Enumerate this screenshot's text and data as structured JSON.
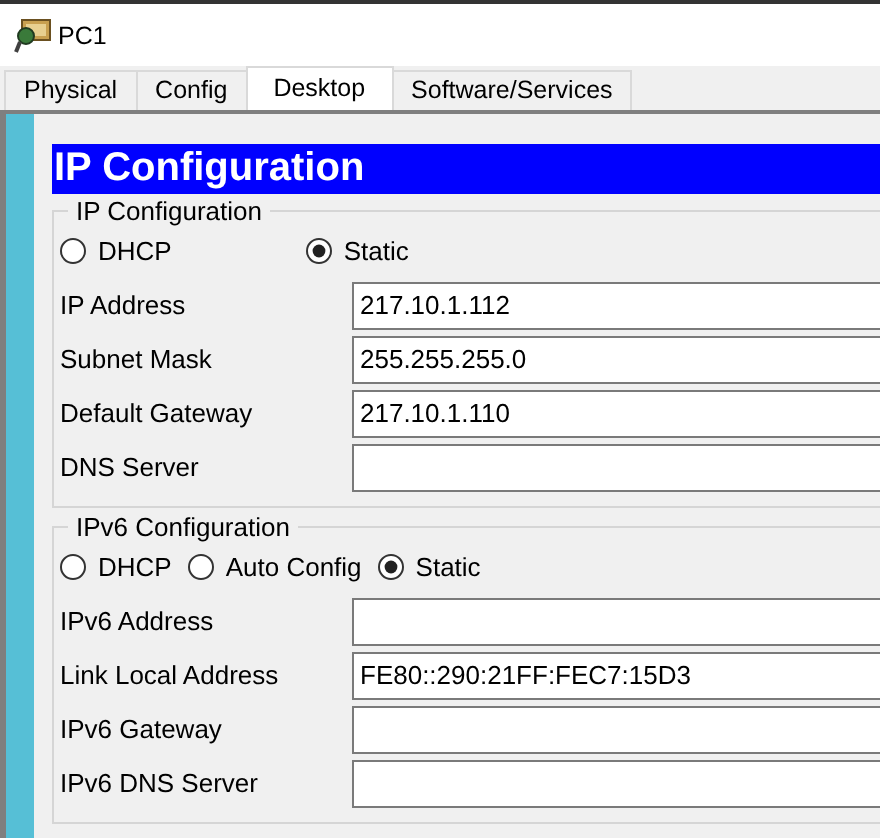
{
  "window": {
    "title": "PC1"
  },
  "tabs": [
    {
      "label": "Physical",
      "selected": false
    },
    {
      "label": "Config",
      "selected": false
    },
    {
      "label": "Desktop",
      "selected": true
    },
    {
      "label": "Software/Services",
      "selected": false
    }
  ],
  "panel": {
    "title": "IP Configuration",
    "groups": [
      {
        "legend": "IP Configuration",
        "modes": [
          {
            "label": "DHCP",
            "selected": false
          },
          {
            "label": "Static",
            "selected": true
          }
        ],
        "fields": [
          {
            "label": "IP Address",
            "value": "217.10.1.112"
          },
          {
            "label": "Subnet Mask",
            "value": "255.255.255.0"
          },
          {
            "label": "Default Gateway",
            "value": "217.10.1.110"
          },
          {
            "label": "DNS Server"
          }
        ]
      },
      {
        "legend": "IPv6 Configuration",
        "modes": [
          {
            "label": "DHCP",
            "selected": false
          },
          {
            "label": "Auto Config",
            "selected": false
          },
          {
            "label": "Static",
            "selected": true
          }
        ],
        "fields": [
          {
            "label": "IPv6 Address"
          },
          {
            "label": "Link Local Address",
            "value": "FE80::290:21FF:FEC7:15D3"
          },
          {
            "label": "IPv6 Gateway"
          },
          {
            "label": "IPv6 DNS Server"
          }
        ]
      }
    ]
  }
}
